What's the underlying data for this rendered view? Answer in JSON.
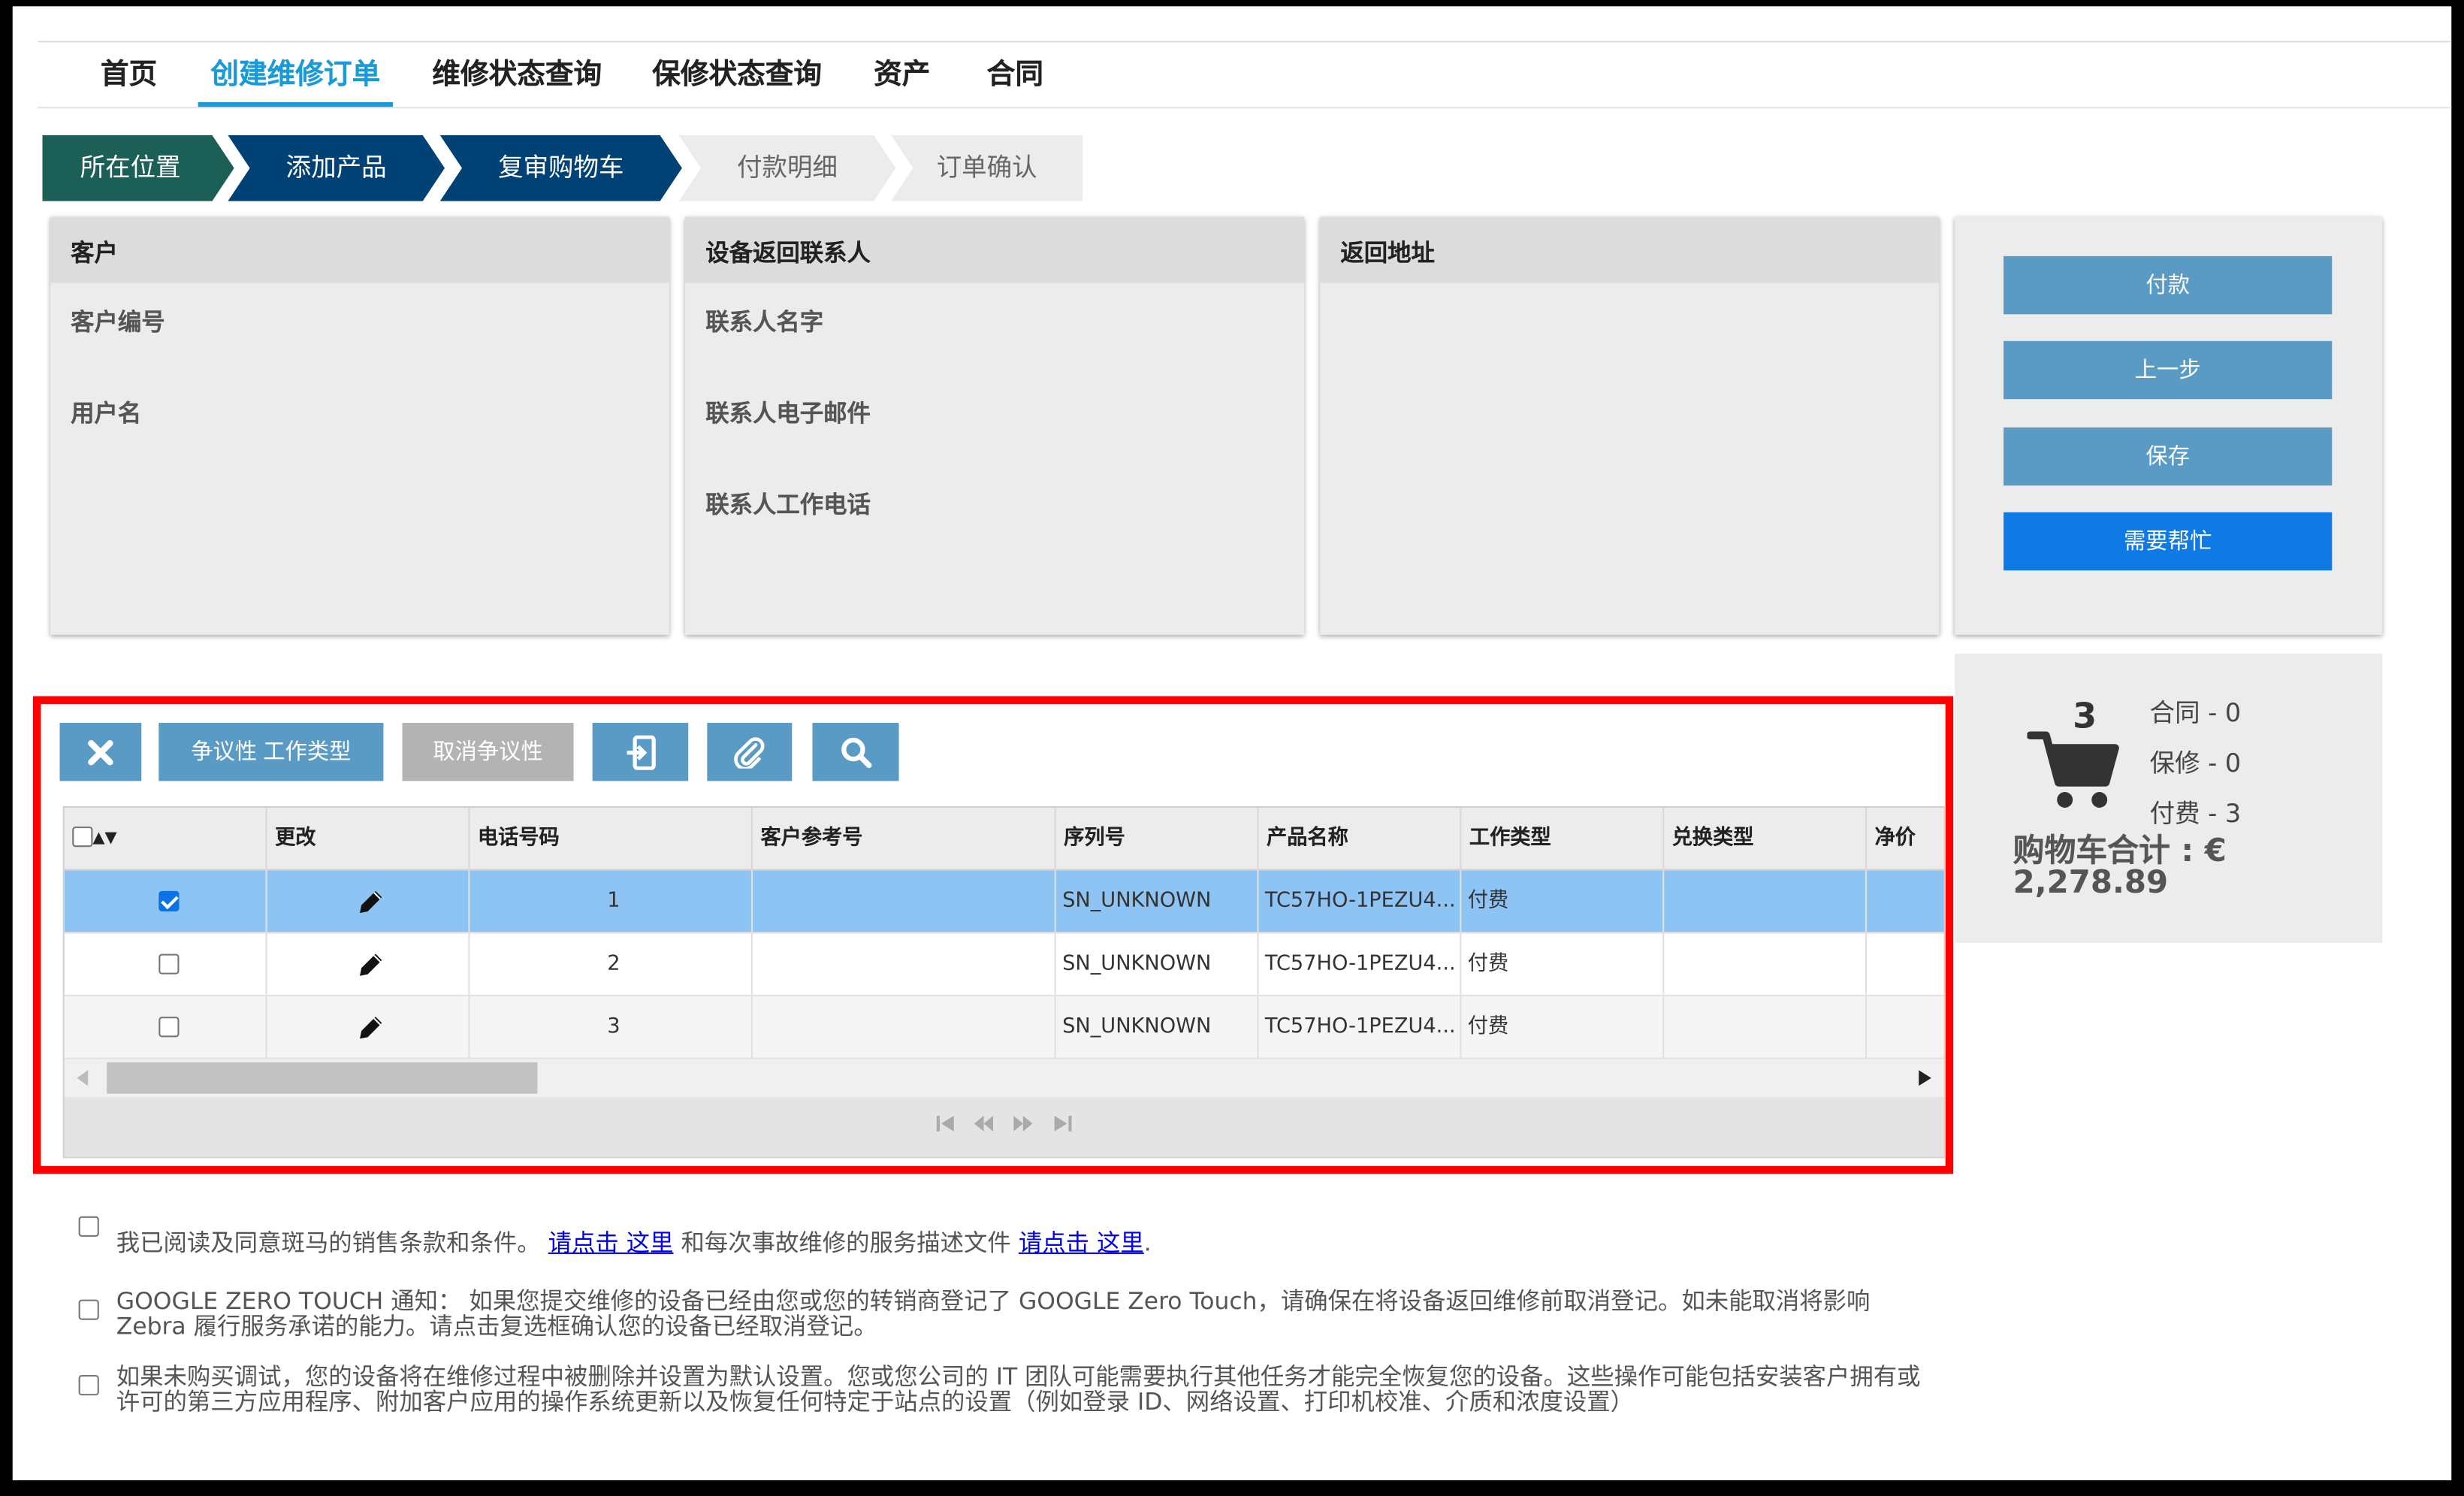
{
  "nav": {
    "items": [
      {
        "label": "首页"
      },
      {
        "label": "创建维修订单"
      },
      {
        "label": "维修状态查询"
      },
      {
        "label": "保修状态查询"
      },
      {
        "label": "资产"
      },
      {
        "label": "合同"
      }
    ],
    "active": "创建维修订单"
  },
  "steps": [
    {
      "label": "所在位置",
      "state": "current"
    },
    {
      "label": "添加产品",
      "state": "done"
    },
    {
      "label": "复审购物车",
      "state": "done"
    },
    {
      "label": "付款明细",
      "state": "pending"
    },
    {
      "label": "订单确认",
      "state": "pending"
    }
  ],
  "customer_panel": {
    "title": "客户",
    "fields": [
      "客户编号",
      "用户名"
    ]
  },
  "contact_panel": {
    "title": "设备返回联系人",
    "fields": [
      "联系人名字",
      "联系人电子邮件",
      "联系人工作电话"
    ]
  },
  "address_panel": {
    "title": "返回地址"
  },
  "actions": {
    "pay": "付款",
    "prev": "上一步",
    "save": "保存",
    "help": "需要帮忙"
  },
  "cart": {
    "count": "3",
    "contract": "合同 - 0",
    "warranty": "保修 - 0",
    "paid": "付费 - 3",
    "total": "购物车合计 : € 2,278.89"
  },
  "toolbar": {
    "delete_icon": "close-icon",
    "dispute_label": "争议性 工作类型",
    "cancel_dispute_label": "取消争议性",
    "device_icon": "device-import-icon",
    "attach_icon": "paperclip-icon",
    "search_icon": "search-icon"
  },
  "grid": {
    "sort_glyph": "▲▼",
    "headers": [
      "更改",
      "电话号码",
      "客户参考号",
      "序列号",
      "产品名称",
      "工作类型",
      "兑换类型",
      "净价"
    ],
    "rows": [
      {
        "checked": true,
        "phone": "1",
        "ref": "",
        "serial": "SN_UNKNOWN",
        "product": "TC57HO-1PEZU4...",
        "work_type": "付费",
        "exchange": ""
      },
      {
        "checked": false,
        "phone": "2",
        "ref": "",
        "serial": "SN_UNKNOWN",
        "product": "TC57HO-1PEZU4...",
        "work_type": "付费",
        "exchange": ""
      },
      {
        "checked": false,
        "phone": "3",
        "ref": "",
        "serial": "SN_UNKNOWN",
        "product": "TC57HO-1PEZU4...",
        "work_type": "付费",
        "exchange": ""
      }
    ]
  },
  "terms": {
    "t1_a": "我已阅读及同意斑马的销售条款和条件。",
    "t1_link1": "请点击 这里",
    "t1_b": "和每次事故维修的服务描述文件",
    "t1_link2": "请点击 这里",
    "t1_c": ".",
    "t2": "GOOGLE ZERO TOUCH 通知：  如果您提交维修的设备已经由您或您的转销商登记了 GOOGLE Zero Touch，请确保在将设备返回维修前取消登记。如未能取消将影响 Zebra 履行服务承诺的能力。请点击复选框确认您的设备已经取消登记。",
    "t3": "如果未购买调试，您的设备将在维修过程中被删除并设置为默认设置。您或您公司的 IT 团队可能需要执行其他任务才能完全恢复您的设备。这些操作可能包括安装客户拥有或许可的第三方应用程序、附加客户应用的操作系统更新以及恢复任何特定于站点的设置（例如登录 ID、网络设置、打印机校准、介质和浓度设置）"
  },
  "colors": {
    "accent": "#1a9ad6",
    "step_current": "#1b5f57",
    "step_done": "#004276",
    "button": "#5a9bc6",
    "help_button": "#0f7ae5",
    "highlight": "#ff0000",
    "row_selected": "#8dc4f3"
  }
}
